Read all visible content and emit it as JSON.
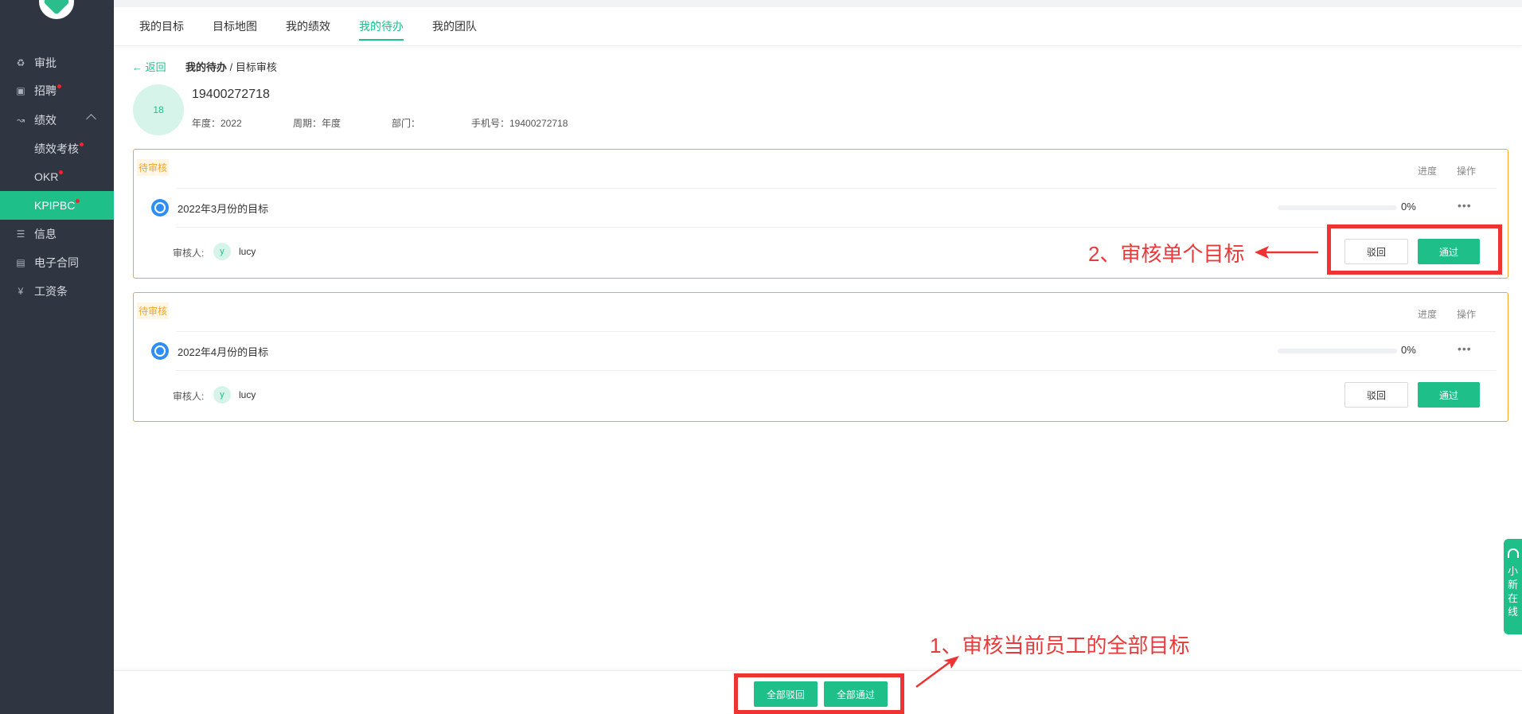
{
  "sidebar": {
    "items": [
      {
        "label": "审批",
        "icon": "stamp-icon"
      },
      {
        "label": "招聘",
        "icon": "recruit-icon",
        "dot": true
      },
      {
        "label": "绩效",
        "icon": "chart-icon",
        "expanded": true
      },
      {
        "label": "绩效考核",
        "sub": true,
        "dot": true
      },
      {
        "label": "OKR",
        "sub": true,
        "dot": true
      },
      {
        "label": "KPIPBC",
        "sub": true,
        "dot": true,
        "active": true
      },
      {
        "label": "信息",
        "icon": "user-list-icon"
      },
      {
        "label": "电子合同",
        "icon": "contract-icon"
      },
      {
        "label": "工资条",
        "icon": "payslip-icon"
      }
    ]
  },
  "tabs": [
    "我的目标",
    "目标地图",
    "我的绩效",
    "我的待办",
    "我的团队"
  ],
  "active_tab": "我的待办",
  "breadcrumb": {
    "back": "← 返回",
    "parent": "我的待办",
    "separator": " / ",
    "current": "目标审核"
  },
  "profile": {
    "avatar_text": "18",
    "name": "19400272718",
    "year": "年度：2022",
    "period": "周期：年度",
    "dept": "部门：",
    "phone": "手机号：19400272718"
  },
  "cards": [
    {
      "status": "待审核",
      "col_progress": "进度",
      "col_action": "操作",
      "title": "2022年3月份的目标",
      "progress": "0%",
      "more": "•••",
      "reviewer_label": "审核人:",
      "reviewer_avatar": "y",
      "reviewer_name": "lucy",
      "reject_label": "驳回",
      "pass_label": "通过"
    },
    {
      "status": "待审核",
      "col_progress": "进度",
      "col_action": "操作",
      "title": "2022年4月份的目标",
      "progress": "0%",
      "more": "•••",
      "reviewer_label": "审核人:",
      "reviewer_avatar": "y",
      "reviewer_name": "lucy",
      "reject_label": "驳回",
      "pass_label": "通过"
    }
  ],
  "annotations": {
    "single": "2、审核单个目标",
    "all": "1、审核当前员工的全部目标"
  },
  "bottom": {
    "reject_all": "全部驳回",
    "pass_all": "全部通过"
  },
  "float_service": [
    "小",
    "新",
    "在",
    "线"
  ],
  "colors": {
    "accent": "#1fbf8a",
    "sidebar_bg": "#2f3541",
    "pending": "#f5a623",
    "annotation": "#ee3333"
  }
}
